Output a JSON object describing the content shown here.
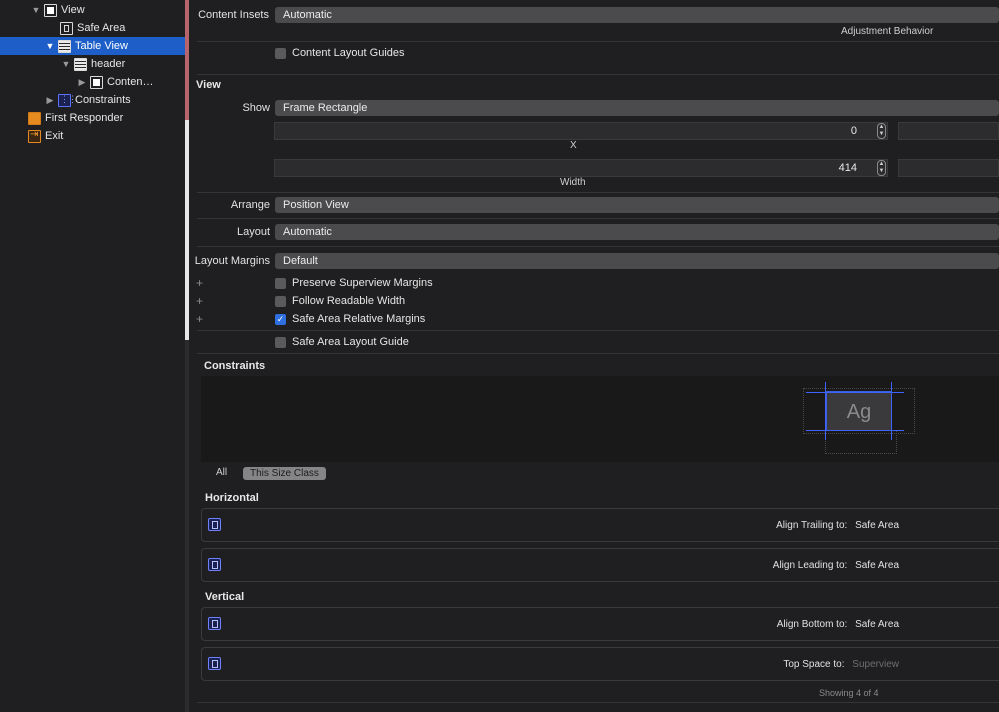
{
  "outline": {
    "items": [
      {
        "label": "View",
        "icon": "view-icon",
        "disclosure": "▼"
      },
      {
        "label": "Safe Area",
        "icon": "safe-area-icon",
        "disclosure": ""
      },
      {
        "label": "Table View",
        "icon": "table-view-icon",
        "disclosure": "▼"
      },
      {
        "label": "header",
        "icon": "table-view-icon",
        "disclosure": "▼"
      },
      {
        "label": "Conten…",
        "icon": "view-icon",
        "disclosure": "▶"
      },
      {
        "label": "Constraints",
        "icon": "constraints-icon",
        "disclosure": "▶"
      },
      {
        "label": "First Responder",
        "icon": "first-responder-icon",
        "disclosure": ""
      },
      {
        "label": "Exit",
        "icon": "exit-icon",
        "disclosure": ""
      }
    ]
  },
  "scroll_view": {
    "content_insets_label": "Content Insets",
    "content_insets_value": "Automatic",
    "adjustment_behavior_caption": "Adjustment Behavior",
    "content_layout_guides_label": "Content Layout Guides"
  },
  "view": {
    "section_title": "View",
    "show_label": "Show",
    "show_value": "Frame Rectangle",
    "x_value": "0",
    "x_caption": "X",
    "width_value": "414",
    "width_caption": "Width",
    "arrange_label": "Arrange",
    "arrange_value": "Position View",
    "layout_label": "Layout",
    "layout_value": "Automatic",
    "layout_margins_label": "Layout Margins",
    "layout_margins_value": "Default",
    "preserve_superview_margins": "Preserve Superview Margins",
    "follow_readable_width": "Follow Readable Width",
    "safe_area_relative_margins": "Safe Area Relative Margins",
    "safe_area_layout_guide": "Safe Area Layout Guide",
    "checked_mark": "✓"
  },
  "constraints": {
    "section_title": "Constraints",
    "preview_text": "Ag",
    "segment_all": "All",
    "segment_size_class": "This Size Class",
    "horizontal_title": "Horizontal",
    "vertical_title": "Vertical",
    "rows": [
      {
        "label": "Align Trailing to:",
        "target": "Safe Area"
      },
      {
        "label": "Align Leading to:",
        "target": "Safe Area"
      },
      {
        "label": "Align Bottom to:",
        "target": "Safe Area"
      },
      {
        "label": "Top Space to:",
        "target": "Superview"
      }
    ],
    "showing": "Showing 4 of 4"
  },
  "colors": {
    "selection": "#1d5ec8",
    "constraint_accent": "#3e63ff",
    "checkbox_on": "#2f6fdf"
  }
}
